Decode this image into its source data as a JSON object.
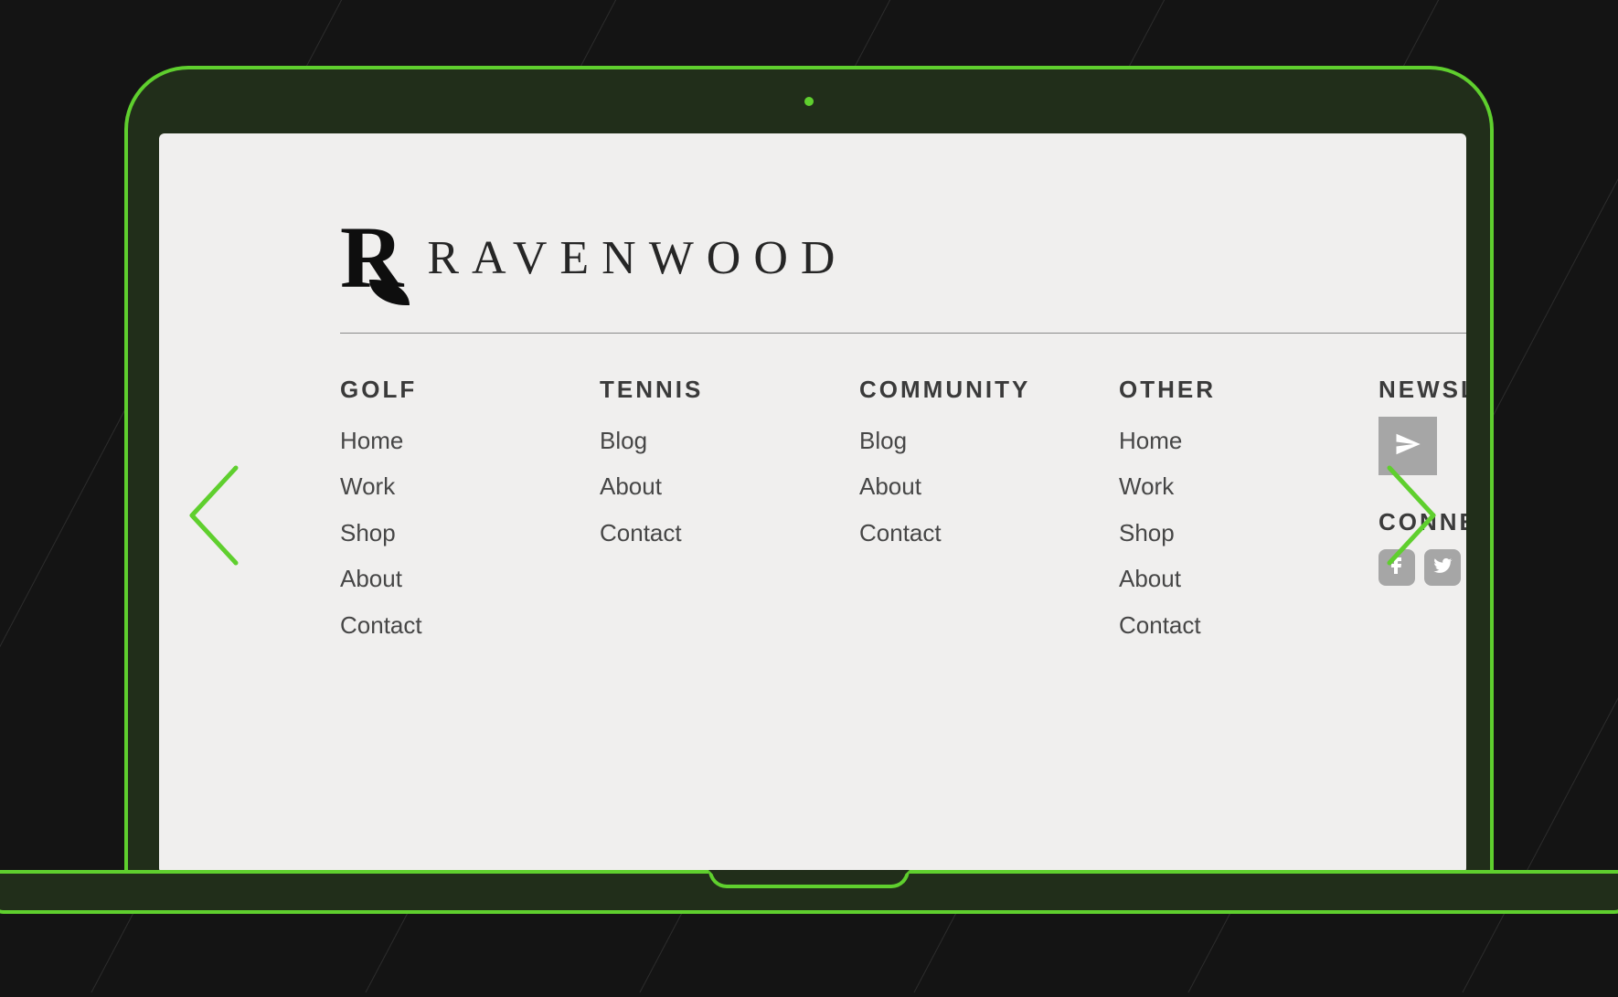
{
  "brand": {
    "mark_letter": "R",
    "name": "RAVENWOOD"
  },
  "columns": [
    {
      "heading": "GOLF",
      "links": [
        "Home",
        "Work",
        "Shop",
        "About",
        "Contact"
      ]
    },
    {
      "heading": "TENNIS",
      "links": [
        "Blog",
        "About",
        "Contact"
      ]
    },
    {
      "heading": "COMMUNITY",
      "links": [
        "Blog",
        "About",
        "Contact"
      ]
    },
    {
      "heading": "OTHER",
      "links": [
        "Home",
        "Work",
        "Shop",
        "About",
        "Contact"
      ]
    }
  ],
  "right": {
    "newsletter_heading": "NEWSL",
    "connect_heading": "CONNE"
  },
  "colors": {
    "accent": "#5fcf2e",
    "panel": "#f0efee",
    "bg": "#141414"
  }
}
